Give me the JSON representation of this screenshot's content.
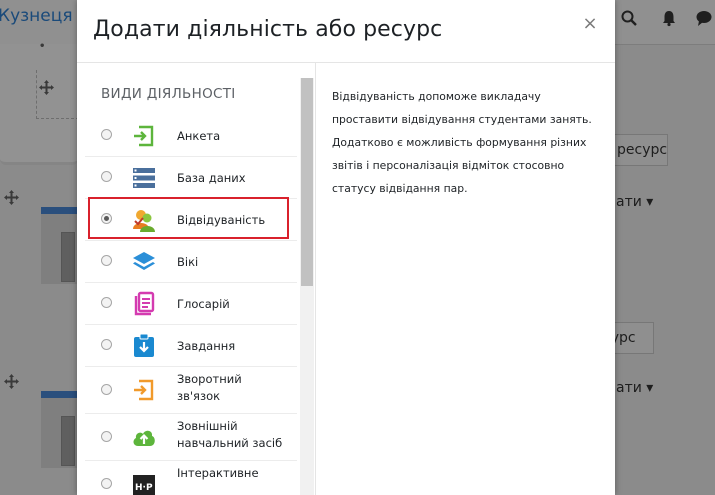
{
  "background": {
    "site_title": "Кузнеця",
    "add_resource_button": "ресурс",
    "add_resource_button_2": "сурс",
    "edit_link": "ати",
    "edit_link_2": "ати"
  },
  "modal": {
    "title": "Додати діяльність або ресурс",
    "close_symbol": "×",
    "section_heading": "ВИДИ ДІЯЛЬНОСТІ",
    "items": [
      {
        "label": "Анкета",
        "icon": "questionnaire-icon",
        "color": "#5db53c"
      },
      {
        "label": "База даних",
        "icon": "database-icon",
        "color": "#4a6f9c"
      },
      {
        "label": "Відвідуваність",
        "icon": "attendance-icon",
        "color": "#7cbf2e",
        "selected": true
      },
      {
        "label": "Вікі",
        "icon": "wiki-layers-icon",
        "color": "#2b8fd8"
      },
      {
        "label": "Глосарій",
        "icon": "glossary-icon",
        "color": "#d43bb0"
      },
      {
        "label": "Завдання",
        "icon": "assignment-icon",
        "color": "#1a89d0"
      },
      {
        "label": "Зворотний зв'язок",
        "icon": "feedback-icon",
        "color": "#f19a2b"
      },
      {
        "label": "Зовнішній навчальний засіб",
        "icon": "external-tool-icon",
        "color": "#5db53c"
      },
      {
        "label": "Інтерактивне",
        "icon": "h5p-icon",
        "color": "#222222"
      }
    ],
    "description": "Відвідуваність допоможе викладачу проставити відвідування студентами занять. Додатково є можливість формування різних звітів і персоналізація відміток стосовно статусу відвідання пар."
  }
}
